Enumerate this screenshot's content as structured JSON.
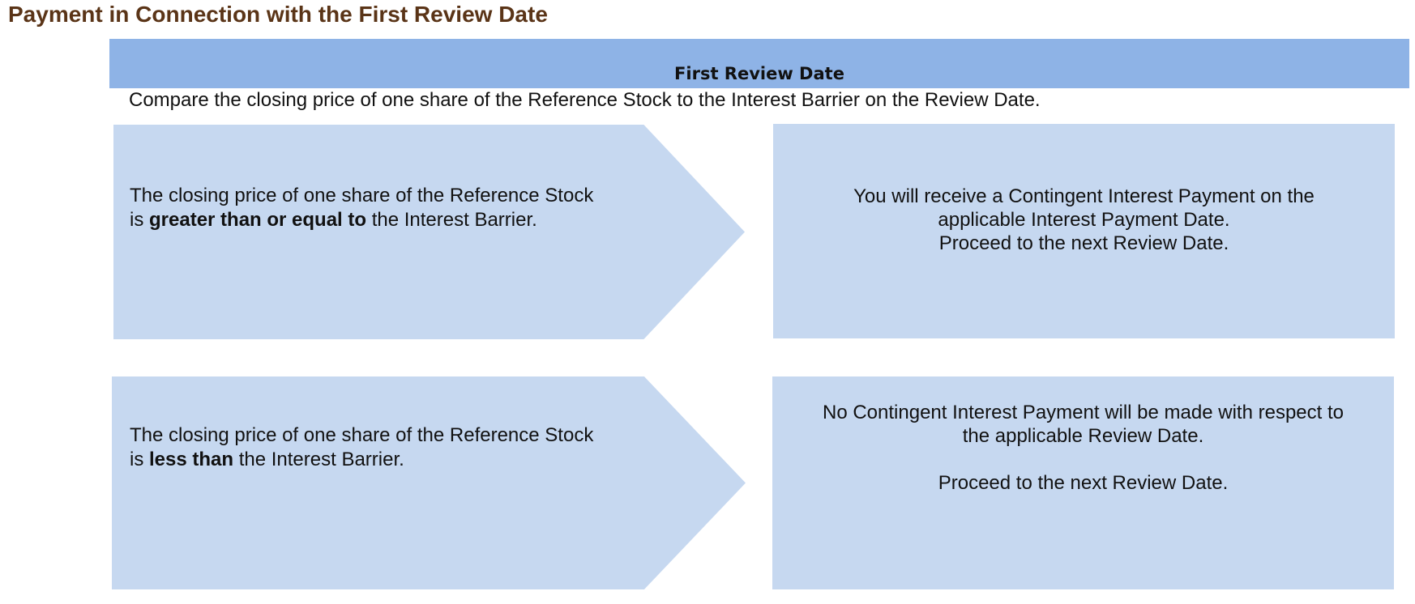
{
  "title": "Payment in Connection with the First Review Date",
  "header": {
    "label": "First Review Date"
  },
  "intro": "Compare the closing price of one share of the Reference Stock to the Interest Barrier on the Review Date.",
  "rows": [
    {
      "condition": {
        "line1": "The closing price of one share of the Reference Stock",
        "line2_prefix": "is ",
        "line2_bold": "greater than or equal to",
        "line2_suffix": " the Interest Barrier."
      },
      "outcome": {
        "line1": "You will receive a Contingent Interest Payment on the",
        "line2": "applicable Interest Payment Date.",
        "line3": "Proceed to the next Review Date."
      }
    },
    {
      "condition": {
        "line1": "The closing price of one share of the Reference Stock",
        "line2_prefix": "is ",
        "line2_bold": "less than",
        "line2_suffix": " the Interest Barrier."
      },
      "outcome": {
        "line1": "No Contingent Interest Payment will be made with respect to",
        "line2": "the applicable Review Date.",
        "line3": "Proceed to the next Review Date."
      }
    }
  ],
  "colors": {
    "title": "#5a3417",
    "header_band": "#8eb3e6",
    "shape_fill": "#c6d8f0",
    "text": "#111111"
  }
}
